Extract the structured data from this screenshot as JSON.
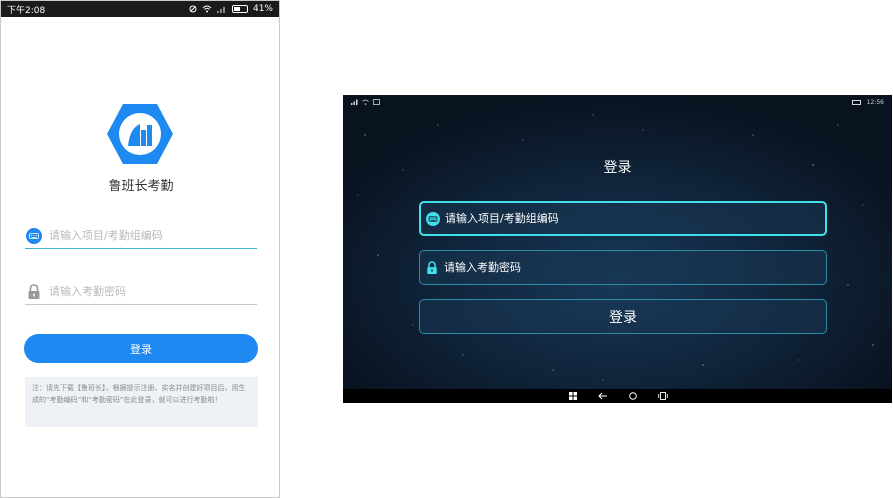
{
  "phone": {
    "status": {
      "time": "下午2:08",
      "battery": "41%"
    },
    "app_name": "鲁班长考勤",
    "project_field": {
      "placeholder": "请输入项目/考勤组编码"
    },
    "password_field": {
      "placeholder": "请输入考勤密码"
    },
    "login_label": "登录",
    "note": "注：请先下载【鲁班长】，根据提示注册、实名并创建好项目后，用生成的“考勤编码”和“考勤密码”在此登录，就可以进行考勤啦！",
    "colors": {
      "accent": "#1e8af1",
      "logo": "#1e8af1"
    },
    "icons": [
      "keyboard-icon",
      "lock-icon",
      "building-logo-icon"
    ]
  },
  "tablet": {
    "status": {
      "time": "12:56"
    },
    "title": "登录",
    "project_field": {
      "placeholder": "请输入项目/考勤组编码"
    },
    "password_field": {
      "placeholder": "请输入考勤密码"
    },
    "login_label": "登录",
    "colors": {
      "accent": "#3fe0ea",
      "background": "#0b1626"
    },
    "icons": [
      "windows-icon",
      "back-arrow-icon",
      "home-circle-icon",
      "task-view-icon",
      "keyboard-icon",
      "lock-icon"
    ]
  }
}
